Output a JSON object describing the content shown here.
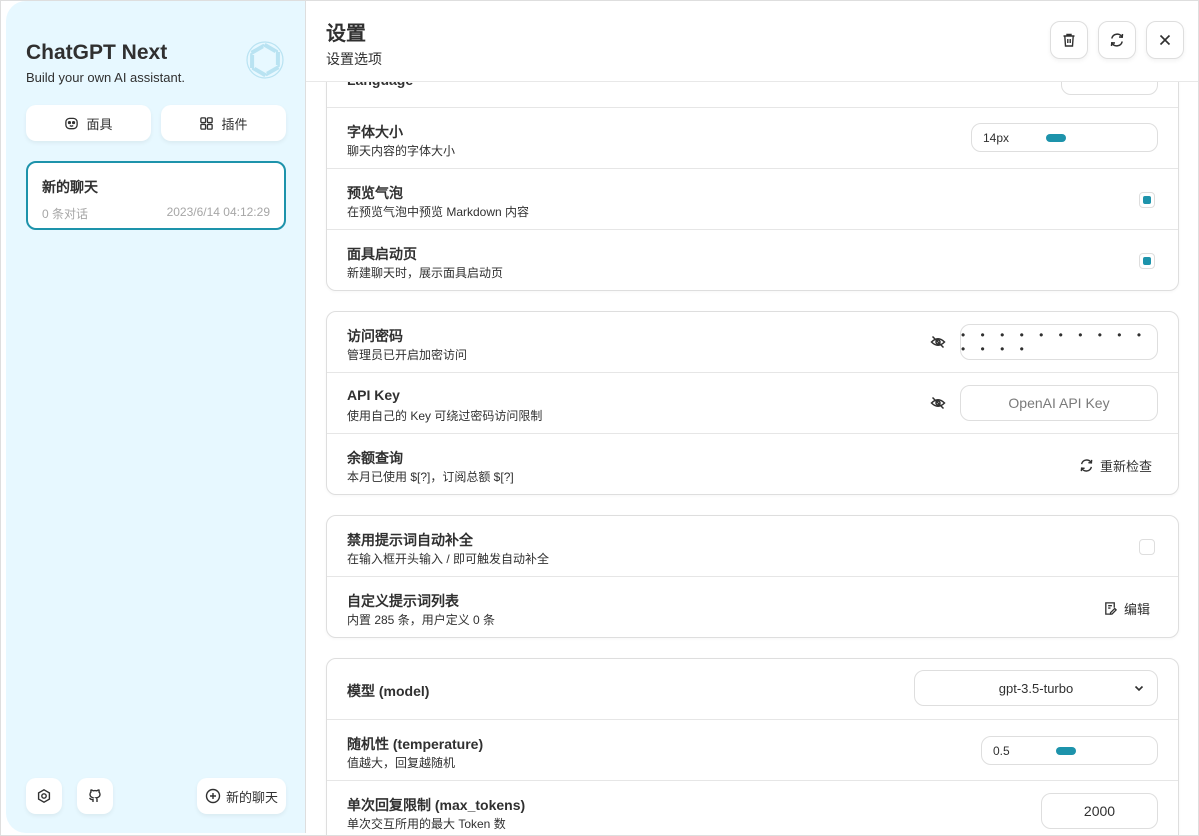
{
  "sidebar": {
    "title": "ChatGPT Next",
    "subtitle": "Build your own AI assistant.",
    "mask_button": "面具",
    "plugin_button": "插件",
    "chat": {
      "title": "新的聊天",
      "count": "0 条对话",
      "time": "2023/6/14 04:12:29"
    },
    "new_chat_button": "新的聊天"
  },
  "header": {
    "title": "设置",
    "subtitle": "设置选项"
  },
  "settings": {
    "language_title": "Language",
    "font_size": {
      "title": "字体大小",
      "sub": "聊天内容的字体大小",
      "value": "14px",
      "level": 0.5
    },
    "preview_bubble": {
      "title": "预览气泡",
      "sub": "在预览气泡中预览 Markdown 内容",
      "checked": true
    },
    "mask_launch": {
      "title": "面具启动页",
      "sub": "新建聊天时，展示面具启动页",
      "checked": true
    },
    "access_code": {
      "title": "访问密码",
      "sub": "管理员已开启加密访问",
      "value": "• • • • • • • • • • • • • •"
    },
    "api_key": {
      "title": "API Key",
      "sub": "使用自己的 Key 可绕过密码访问限制",
      "placeholder": "OpenAI API Key"
    },
    "balance": {
      "title": "余额查询",
      "sub": "本月已使用 $[?]，订阅总额 $[?]",
      "button": "重新检查"
    },
    "disable_autocomplete": {
      "title": "禁用提示词自动补全",
      "sub": "在输入框开头输入 / 即可触发自动补全",
      "checked": false
    },
    "custom_prompts": {
      "title": "自定义提示词列表",
      "sub": "内置 285 条，用户定义 0 条",
      "button": "编辑"
    },
    "model": {
      "title": "模型 (model)",
      "value": "gpt-3.5-turbo"
    },
    "temperature": {
      "title": "随机性 (temperature)",
      "sub": "值越大，回复越随机",
      "value": "0.5",
      "level": 0.5
    },
    "max_tokens": {
      "title": "单次回复限制 (max_tokens)",
      "sub": "单次交互所用的最大 Token 数",
      "value": "2000"
    }
  },
  "colors": {
    "accent": "#1d93ab",
    "sidebar_bg": "#e7f8ff",
    "border": "#dedede"
  }
}
